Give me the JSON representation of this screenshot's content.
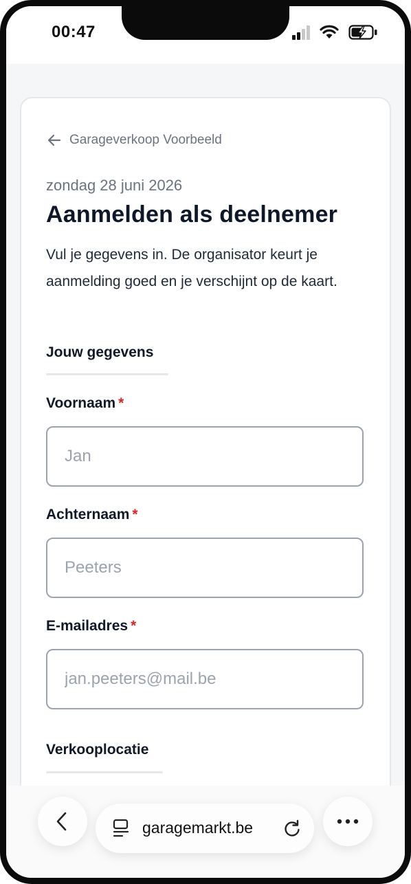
{
  "status_bar": {
    "time": "00:47",
    "icons": [
      "signal-icon",
      "wifi-icon",
      "battery-charging-icon"
    ]
  },
  "page": {
    "back_link_label": "Garageverkoop Voorbeeld",
    "date": "zondag 28 juni 2026",
    "title": "Aanmelden als deelnemer",
    "intro": "Vul je gegevens in. De organisator keurt je aanmelding goed en je verschijnt op de kaart.",
    "section_personal": "Jouw gegevens",
    "section_location": "Verkooplocatie",
    "required_marker": "*",
    "fields": {
      "first_name": {
        "label": "Voornaam",
        "placeholder": "Jan",
        "value": ""
      },
      "last_name": {
        "label": "Achternaam",
        "placeholder": "Peeters",
        "value": ""
      },
      "email": {
        "label": "E-mailadres",
        "placeholder": "jan.peeters@mail.be",
        "value": ""
      }
    }
  },
  "browser": {
    "url": "garagemarkt.be",
    "icons": [
      "back-chevron-icon",
      "tabs-icon",
      "reload-icon",
      "more-icon"
    ]
  },
  "colors": {
    "required": "#dc2626",
    "muted_text": "#6b7280",
    "border": "#9ca3af",
    "page_background": "#f5f6f8"
  }
}
